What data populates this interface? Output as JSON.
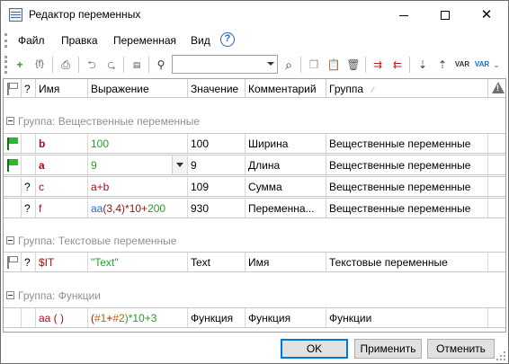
{
  "window": {
    "title": "Редактор переменных"
  },
  "menu": {
    "items": [
      "Файл",
      "Правка",
      "Переменная",
      "Вид"
    ],
    "help_symbol": "?"
  },
  "toolbar": {
    "icons": [
      "add-variable-icon",
      "add-function-icon",
      "print-icon",
      "undo-icon",
      "redo-icon",
      "properties-icon",
      "find-icon",
      "search-icon",
      "copy-icon",
      "paste-icon",
      "delete-icon",
      "export-icon",
      "import-icon",
      "sort-asc-icon",
      "sort-desc-icon",
      "var-icon",
      "var-check-icon"
    ],
    "search_value": ""
  },
  "grid": {
    "columns": [
      "",
      "?",
      "Имя",
      "Выражение",
      "Значение",
      "Комментарий",
      "Группа",
      ""
    ],
    "groups": [
      {
        "label": "Группа: Вещественные переменные",
        "rows": [
          {
            "flag": "green",
            "q": "",
            "name": "b",
            "expression": "100",
            "value": "100",
            "comment": "Ширина",
            "group": "Вещественные переменные"
          },
          {
            "flag": "green",
            "q": "",
            "name": "a",
            "expression": "9",
            "value": "9",
            "comment": "Длина",
            "group": "Вещественные переменные"
          },
          {
            "flag": "",
            "q": "?",
            "name": "c",
            "expression": "a+b",
            "value": "109",
            "comment": "Сумма",
            "group": "Вещественные переменные"
          },
          {
            "flag": "",
            "q": "?",
            "name": "f",
            "expression_parts": [
              "aa",
              "(3,4)*10+",
              "200"
            ],
            "value": "930",
            "comment": "Переменна...",
            "group": "Вещественные переменные"
          }
        ]
      },
      {
        "label": "Группа: Текстовые переменные",
        "rows": [
          {
            "flag": "gray",
            "q": "?",
            "name": "$IT",
            "expression": "\"Text\"",
            "value": "Text",
            "comment": "Имя",
            "group": "Текстовые переменные"
          }
        ]
      },
      {
        "label": "Группа: Функции",
        "rows": [
          {
            "flag": "",
            "q": "",
            "name": "aa ( )",
            "expression_parts": [
              "(",
              "#1",
              "+",
              "#2",
              ")*10+3"
            ],
            "value": "Функция",
            "comment": "Функция",
            "group": "Функции"
          }
        ]
      }
    ]
  },
  "buttons": {
    "ok": "OK",
    "apply": "Применить",
    "cancel": "Отменить"
  },
  "colors": {
    "accent": "#0078d7",
    "flag_green": "#2fb82f",
    "name_red": "#a01010",
    "expr_green": "#2a9a2a",
    "expr_blue": "#1a6bd0"
  }
}
